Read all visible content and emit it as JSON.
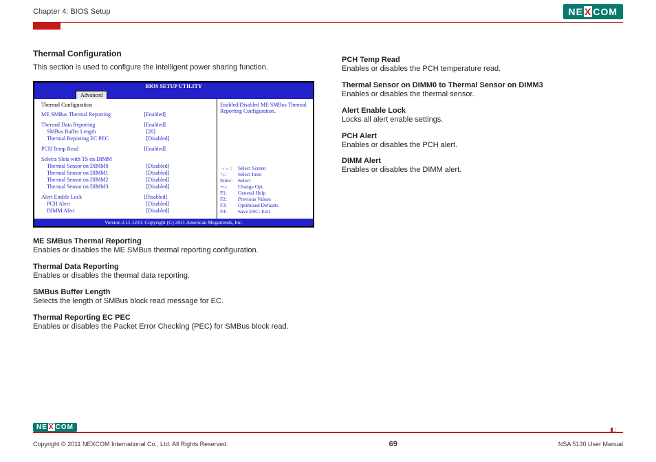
{
  "header": {
    "chapter": "Chapter 4: BIOS Setup",
    "logo_left": "NE",
    "logo_x": "X",
    "logo_right": "COM"
  },
  "left": {
    "title": "Thermal Configuration",
    "desc": "This section is used to configure the intelligent power sharing function."
  },
  "bios": {
    "title": "BIOS SETUP UTILITY",
    "tab": "Advanced",
    "heading": "Thermal Configuration",
    "rows": [
      {
        "label": "ME SMBus Thermal Reporting",
        "val": "[Enabled]",
        "indent": false
      },
      {
        "label": "",
        "val": "",
        "indent": false,
        "spacer": true
      },
      {
        "label": "Thermal Data Reporting",
        "val": "[Enabled]",
        "indent": false
      },
      {
        "label": "SMBus Buffer Length",
        "val": "[20]",
        "indent": true
      },
      {
        "label": "Thermal Reporting EC PEC",
        "val": "[Disabled]",
        "indent": true
      },
      {
        "label": "",
        "val": "",
        "indent": false,
        "spacer": true
      },
      {
        "label": "PCH Temp Read",
        "val": "[Enabled]",
        "indent": false
      },
      {
        "label": "",
        "val": "",
        "indent": false,
        "spacer": true
      },
      {
        "label": "Selects Slots with TS on DIMM",
        "val": "",
        "indent": false
      },
      {
        "label": "Thermal Sensor on DIMM0",
        "val": "[Disabled]",
        "indent": true
      },
      {
        "label": "Thermal Sensor on DIMM1",
        "val": "[Disabled]",
        "indent": true
      },
      {
        "label": "Thermal Sensor on DIMM2",
        "val": "[Disabled]",
        "indent": true
      },
      {
        "label": "Thermal Sensor on DIMM3",
        "val": "[Disabled]",
        "indent": true
      },
      {
        "label": "",
        "val": "",
        "indent": false,
        "spacer": true
      },
      {
        "label": "Alert Enable Lock",
        "val": "[Disabled]",
        "indent": false
      },
      {
        "label": "PCH Alert",
        "val": "[Disabled]",
        "indent": true
      },
      {
        "label": "DIMM Alert",
        "val": "[Disabled]",
        "indent": true
      }
    ],
    "right_top": "Enabled/Disabled ME SMBus Thermal Reporting Configuration.",
    "help": [
      {
        "k": "→←:",
        "v": "Select Screen"
      },
      {
        "k": "↑↓:",
        "v": "Select Item"
      },
      {
        "k": "Enter:",
        "v": "Select"
      },
      {
        "k": "+/-:",
        "v": "Change Opt."
      },
      {
        "k": "F1:",
        "v": "General Help"
      },
      {
        "k": "F2:",
        "v": "Previous Values"
      },
      {
        "k": "F3:",
        "v": "Optimized Defaults"
      },
      {
        "k": "F4:",
        "v": "Save   ESC: Exit"
      }
    ],
    "footer": "Version 2.11.1210. Copyright (C) 2011 American Megatrends, Inc."
  },
  "left_items": [
    {
      "t": "ME SMBus Thermal Reporting",
      "d": "Enables or disables the ME SMBus thermal reporting configuration."
    },
    {
      "t": "Thermal Data Reporting",
      "d": "Enables or disables the thermal data reporting."
    },
    {
      "t": "SMBus Buffer Length",
      "d": "Selects the length of SMBus block read message for EC."
    },
    {
      "t": "Thermal Reporting EC PEC",
      "d": "Enables or disables the Packet Error Checking (PEC) for SMBus block read."
    }
  ],
  "right_items": [
    {
      "t": "PCH Temp Read",
      "d": "Enables or disables the PCH temperature read."
    },
    {
      "t": "Thermal Sensor on DIMM0 to Thermal Sensor on DIMM3",
      "d": "Enables or disables the thermal sensor."
    },
    {
      "t": "Alert Enable Lock",
      "d": "Locks all alert enable settings."
    },
    {
      "t": "PCH Alert",
      "d": "Enables or disables the PCH alert."
    },
    {
      "t": "DIMM Alert",
      "d": "Enables or disables the DIMM alert."
    }
  ],
  "footer": {
    "copyright": "Copyright © 2011 NEXCOM International Co., Ltd. All Rights Reserved.",
    "page": "69",
    "manual": "NSA 5130 User Manual"
  }
}
